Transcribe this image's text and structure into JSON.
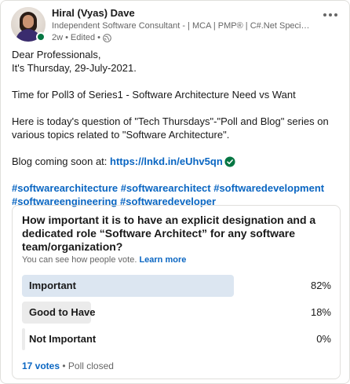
{
  "author": {
    "name": "Hiral (Vyas) Dave",
    "headline": "Independent Software Consultant - | MCA | PMP® | C#.Net Specialist | CPSA-...",
    "time": "2w",
    "edited": "Edited",
    "dot": "•",
    "visibility_icon": "globe-icon",
    "online_status_color": "#057642"
  },
  "post": {
    "line1": "Dear Professionals,",
    "line2": "It's Thursday, 29-July-2021.",
    "line3": "Time for Poll3 of Series1 - Software Architecture Need vs Want",
    "line4": "Here is today's question of \"Tech Thursdays\"-\"Poll and Blog\" series on various topics related to \"Software Architecture\".",
    "blog_prefix": "Blog coming soon at: ",
    "blog_link": "https://lnkd.in/eUhv5qn",
    "hashtags_line1": "#softwarearchitecture #softwarearchitect #softwaredevelopment",
    "hashtags_line2": "#softwareengineering #softwaredeveloper"
  },
  "poll": {
    "question": "How important it is to have an explicit designation and a dedicated role “Software Architect” for any software team/organization?",
    "note": "You can see how people vote.",
    "learn_more": "Learn more",
    "options": [
      {
        "label": "Important",
        "percent": "82%",
        "value": 0.82
      },
      {
        "label": "Good to Have",
        "percent": "18%",
        "value": 0.18
      },
      {
        "label": "Not Important",
        "percent": "0%",
        "value": 0.0
      }
    ],
    "votes": "17 votes",
    "status": "• Poll closed"
  },
  "colors": {
    "accent": "#0a66c2",
    "winning_bar": "#dce6f1",
    "other_bar": "#ebebeb",
    "verified": "#057642"
  }
}
